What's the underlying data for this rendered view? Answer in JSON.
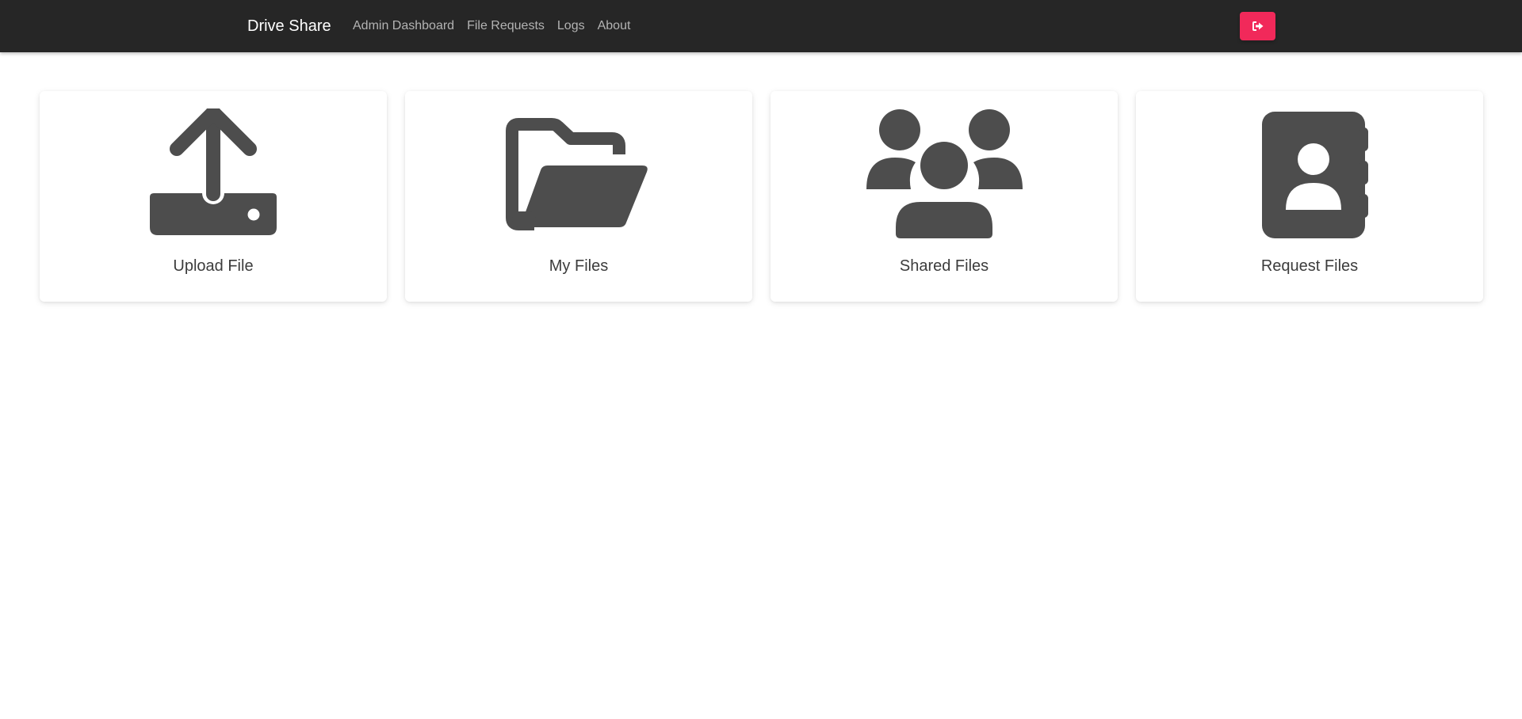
{
  "navbar": {
    "brand": "Drive Share",
    "links": [
      "Admin Dashboard",
      "File Requests",
      "Logs",
      "About"
    ],
    "logout_icon": "sign-out-icon"
  },
  "cards": [
    {
      "label": "Upload File",
      "icon": "upload-icon"
    },
    {
      "label": "My Files",
      "icon": "folder-open-icon"
    },
    {
      "label": "Shared Files",
      "icon": "users-icon"
    },
    {
      "label": "Request Files",
      "icon": "address-book-icon"
    }
  ],
  "colors": {
    "navbar_bg": "#262626",
    "logout_button": "#f1295a",
    "icon_fill": "#4d4d4d"
  }
}
